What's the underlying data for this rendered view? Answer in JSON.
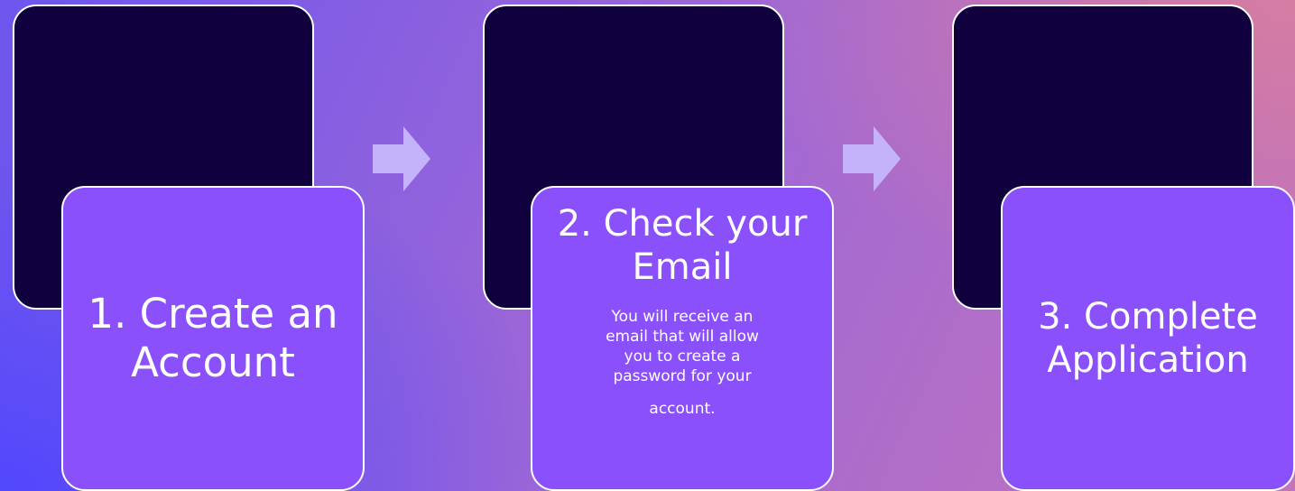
{
  "steps": [
    {
      "title": "1. Create an Account"
    },
    {
      "title": "2. Check your Email",
      "description_main": "You will receive an email that will allow you to create a password for your",
      "description_tail": "account."
    },
    {
      "title": "3. Complete Application"
    }
  ],
  "colors": {
    "back_card": "#10003d",
    "front_card": "#8a50fb",
    "arrow": "#c4b3fb",
    "text": "#ffffff"
  },
  "icons": [
    "right-arrow-icon",
    "right-arrow-icon"
  ]
}
